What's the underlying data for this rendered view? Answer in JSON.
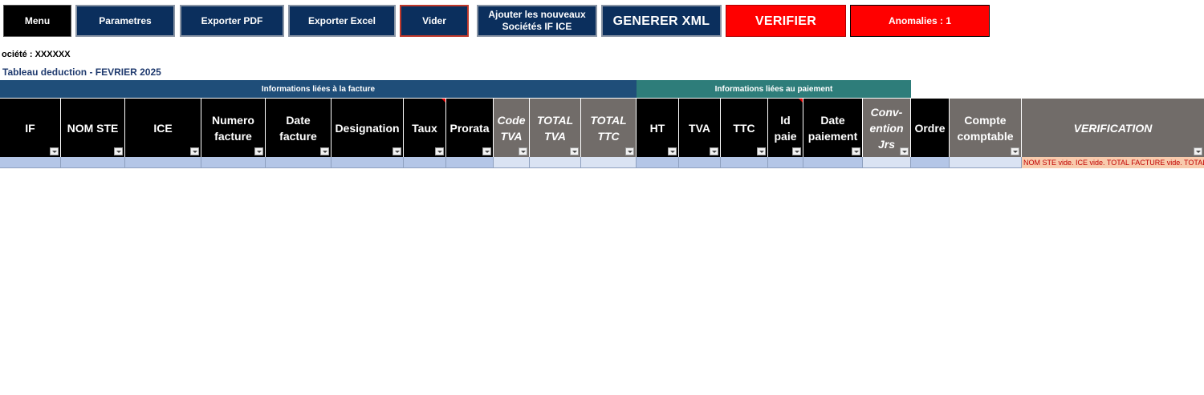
{
  "toolbar": {
    "menu": "Menu",
    "parametres": "Parametres",
    "exporter_pdf": "Exporter PDF",
    "exporter_excel": "Exporter Excel",
    "vider": "Vider",
    "ajouter_line1": "Ajouter les nouveaux",
    "ajouter_line2": "Sociétés IF ICE",
    "generer_xml": "GENERER XML",
    "verifier": "VERIFIER",
    "anomalies": "Anomalies : 1"
  },
  "societe_label": "ociété : XXXXXX",
  "table_title": "Tableau deduction - FEVRIER 2025",
  "groups": {
    "facture": "Informations liées à la facture",
    "paiement": "Informations liées au paiement"
  },
  "columns": {
    "if": "IF",
    "nom_ste": "NOM STE",
    "ice": "ICE",
    "numero_facture": "Numero\nfacture",
    "date_facture": "Date\nfacture",
    "designation": "Designation",
    "taux": "Taux",
    "prorata": "Prorata",
    "code_tva": "Code\nTVA",
    "total_tva": "TOTAL\nTVA",
    "total_ttc": "TOTAL\nTTC",
    "ht": "HT",
    "tva": "TVA",
    "ttc": "TTC",
    "id_paie": "Id\npaie",
    "date_paiement": "Date\npaiement",
    "convention_jrs": "Conv-\nention\nJrs",
    "ordre": "Ordre",
    "compte_comptable": "Compte\ncomptable",
    "verification": "VERIFICATION"
  },
  "row1": {
    "verification": "NOM STE vide. ICE vide. TOTAL FACTURE vide. TOTAL TVA vide."
  },
  "colors": {
    "navy": "#0b2f5d",
    "group_facture": "#1f4e79",
    "group_paiement": "#2e7d7a",
    "header_black": "#000000",
    "header_gray": "#716c69",
    "alert_red": "#ff0000"
  }
}
